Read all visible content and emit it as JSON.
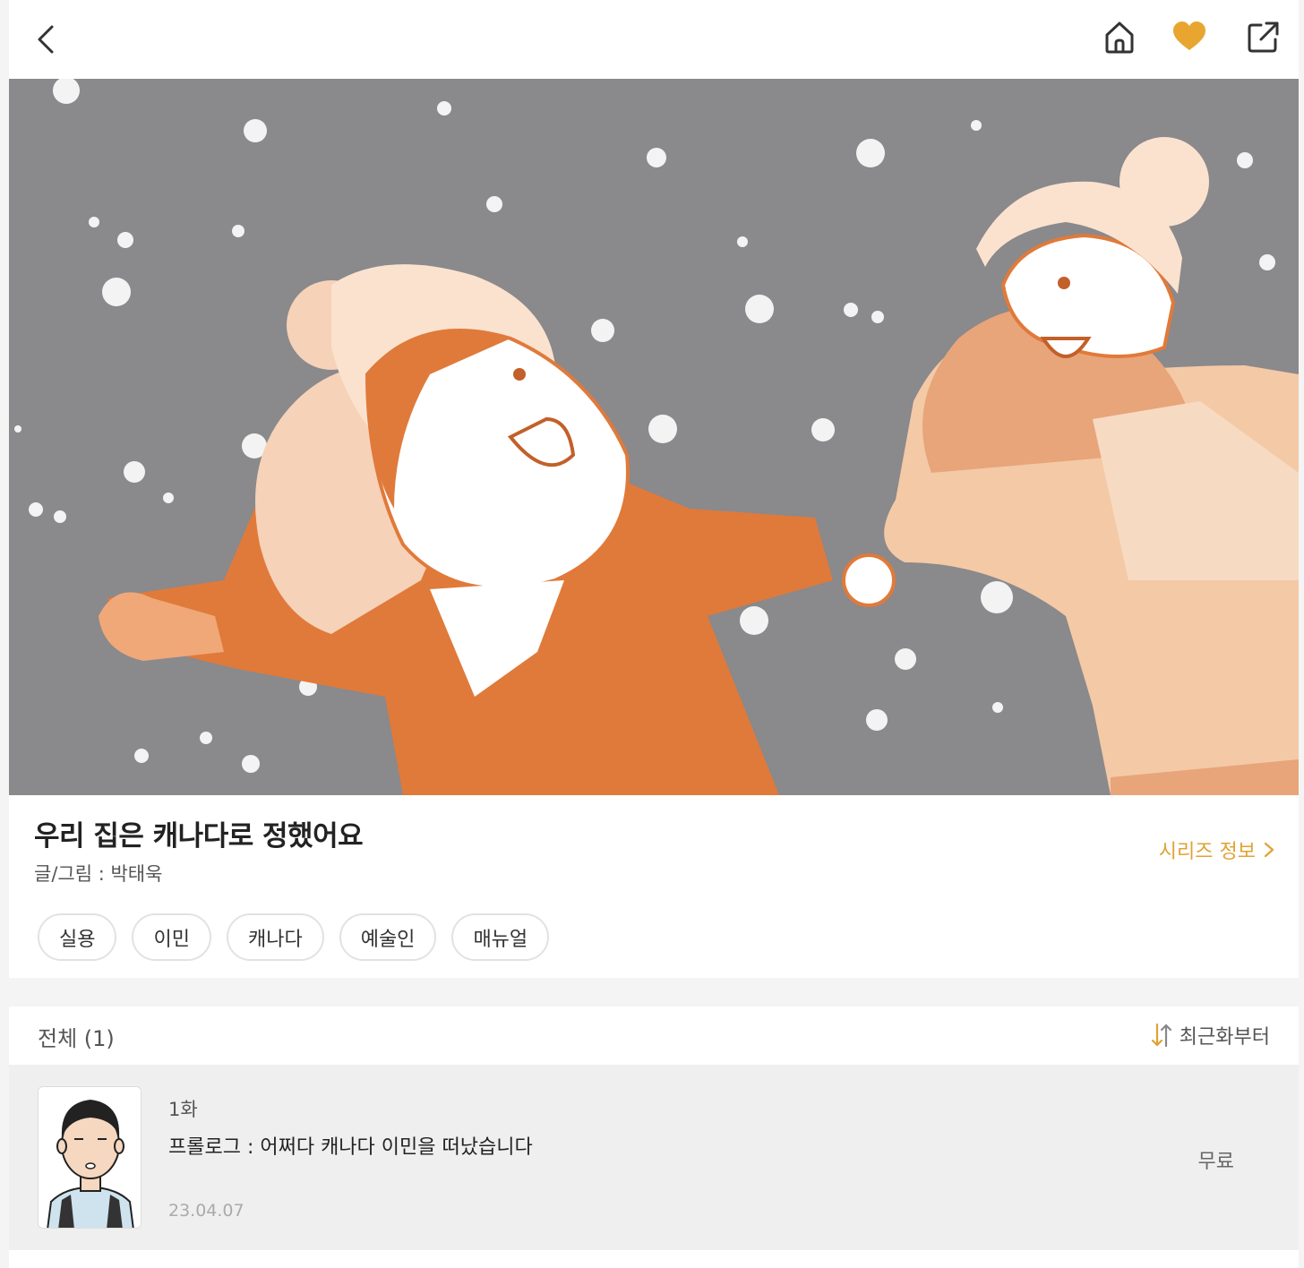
{
  "topbar": {
    "icons": [
      "back-arrow-icon",
      "home-icon",
      "heart-icon",
      "share-icon"
    ],
    "accent_color": "#e8a630"
  },
  "series": {
    "title": "우리 집은 캐나다로 정했어요",
    "author": "글/그림 : 박태욱",
    "info_link": "시리즈 정보",
    "tags": [
      "실용",
      "이민",
      "캐나다",
      "예술인",
      "매뉴얼"
    ]
  },
  "list": {
    "count_label": "전체 (1)",
    "sort_label": "최근화부터"
  },
  "episodes": [
    {
      "number": "1화",
      "title": "프롤로그 : 어쩌다 캐나다 이민을 떠났습니다",
      "date": "23.04.07",
      "price": "무료"
    }
  ],
  "colors": {
    "accent": "#e0a233",
    "hero_bg": "#8a898c",
    "jacket": "#e07a3a"
  }
}
